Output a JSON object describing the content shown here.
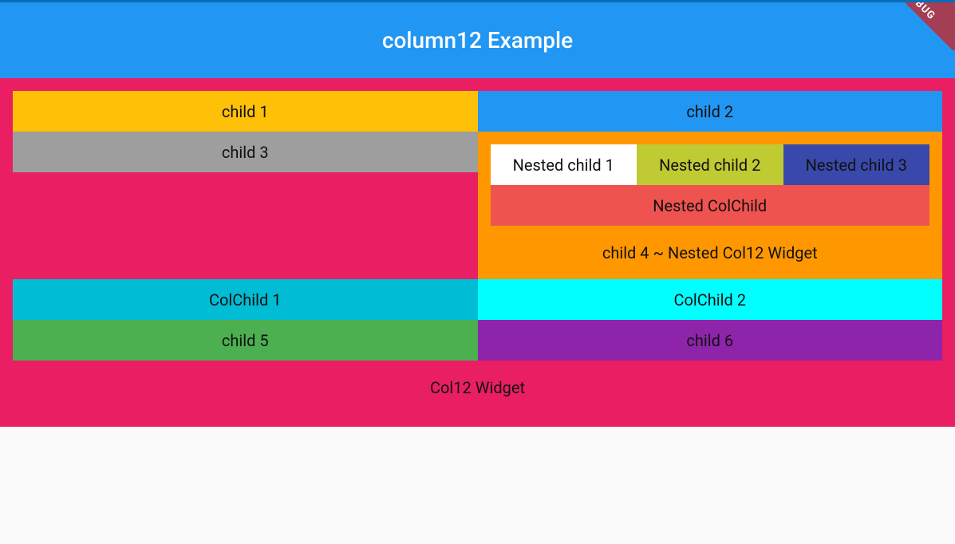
{
  "appbar": {
    "title": "column12 Example"
  },
  "debug_banner": "BUG",
  "grid": {
    "child1": "child 1",
    "child2": "child 2",
    "child3": "child 3",
    "nested": {
      "n1": "Nested child 1",
      "n2": "Nested child 2",
      "n3": "Nested child 3",
      "colchild": "Nested ColChild",
      "label": "child 4 ~ Nested Col12 Widget"
    },
    "colchild1": "ColChild 1",
    "colchild2": "ColChild 2",
    "child5": "child 5",
    "child6": "child 6",
    "footer": "Col12 Widget"
  }
}
